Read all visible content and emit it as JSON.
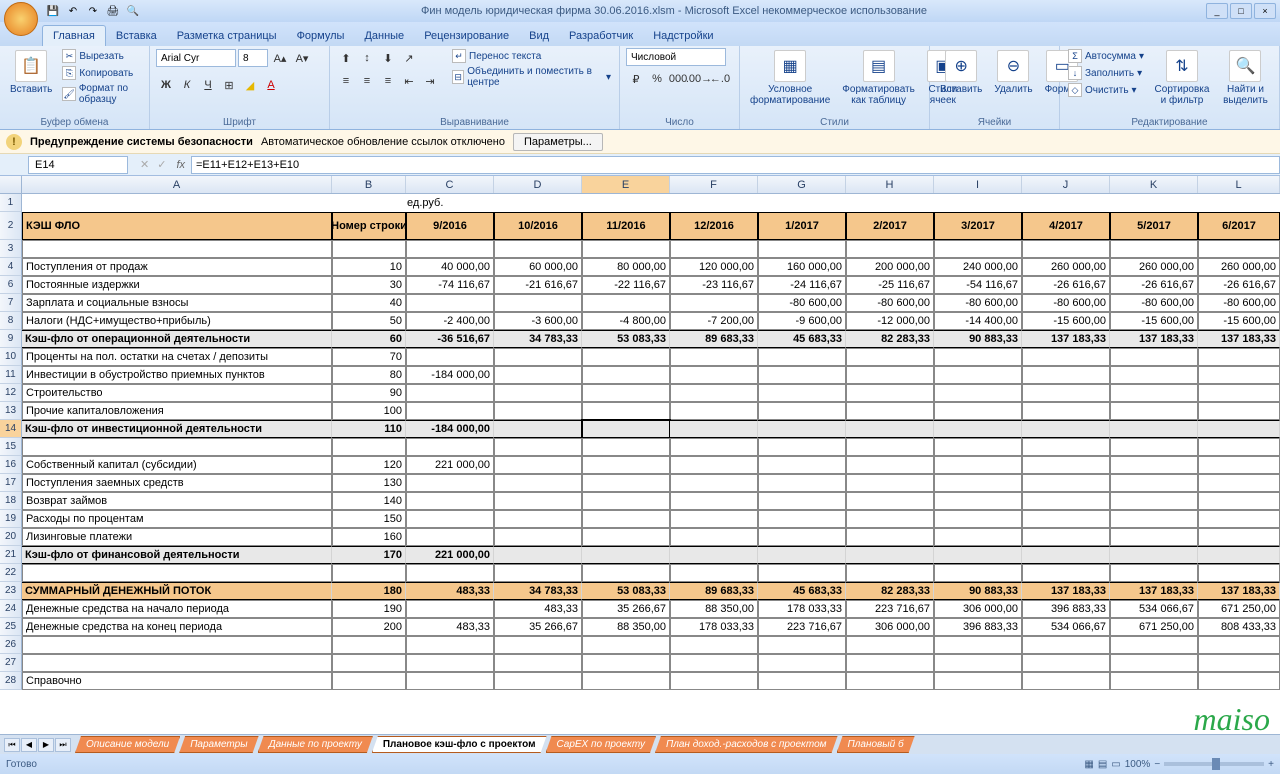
{
  "title": "Фин модель юридическая фирма 30.06.2016.xlsm - Microsoft Excel некоммерческое использование",
  "qat": {
    "save": "💾",
    "undo": "↶",
    "redo": "↷",
    "print": "🖨",
    "preview": "🔍"
  },
  "tabs": [
    "Главная",
    "Вставка",
    "Разметка страницы",
    "Формулы",
    "Данные",
    "Рецензирование",
    "Вид",
    "Разработчик",
    "Надстройки"
  ],
  "ribbon": {
    "clipboard": {
      "paste": "Вставить",
      "cut": "Вырезать",
      "copy": "Копировать",
      "format": "Формат по образцу",
      "label": "Буфер обмена"
    },
    "font": {
      "name": "Arial Cyr",
      "size": "8",
      "label": "Шрифт"
    },
    "align": {
      "wrap": "Перенос текста",
      "merge": "Объединить и поместить в центре",
      "label": "Выравнивание"
    },
    "number": {
      "format": "Числовой",
      "label": "Число"
    },
    "styles": {
      "cond": "Условное форматирование",
      "table": "Форматировать как таблицу",
      "cell": "Стили ячеек",
      "label": "Стили"
    },
    "cells": {
      "insert": "Вставить",
      "delete": "Удалить",
      "format": "Формат",
      "label": "Ячейки"
    },
    "editing": {
      "sum": "Автосумма",
      "fill": "Заполнить",
      "clear": "Очистить",
      "sort": "Сортировка и фильтр",
      "find": "Найти и выделить",
      "label": "Редактирование"
    }
  },
  "warning": {
    "title": "Предупреждение системы безопасности",
    "msg": "Автоматическое обновление ссылок отключено",
    "btn": "Параметры..."
  },
  "namebox": "E14",
  "formula": "=E11+E12+E13+E10",
  "cols": [
    "A",
    "B",
    "C",
    "D",
    "E",
    "F",
    "G",
    "H",
    "I",
    "J",
    "K",
    "L"
  ],
  "unit": "ед.руб.",
  "hdr": {
    "title": "КЭШ ФЛО",
    "rownum": "Номер строки",
    "periods": [
      "9/2016",
      "10/2016",
      "11/2016",
      "12/2016",
      "1/2017",
      "2/2017",
      "3/2017",
      "4/2017",
      "5/2017",
      "6/2017"
    ]
  },
  "rows": [
    {
      "n": 4,
      "label": "Поступления от продаж",
      "rn": "10",
      "v": [
        "40 000,00",
        "60 000,00",
        "80 000,00",
        "120 000,00",
        "160 000,00",
        "200 000,00",
        "240 000,00",
        "260 000,00",
        "260 000,00",
        "260 000,00"
      ]
    },
    {
      "n": 6,
      "label": "Постоянные издержки",
      "rn": "30",
      "v": [
        "-74 116,67",
        "-21 616,67",
        "-22 116,67",
        "-23 116,67",
        "-24 116,67",
        "-25 116,67",
        "-54 116,67",
        "-26 616,67",
        "-26 616,67",
        "-26 616,67"
      ]
    },
    {
      "n": 7,
      "label": "Зарплата и социальные взносы",
      "rn": "40",
      "v": [
        "",
        "",
        "",
        "",
        "-80 600,00",
        "-80 600,00",
        "-80 600,00",
        "-80 600,00",
        "-80 600,00",
        "-80 600,00"
      ]
    },
    {
      "n": 8,
      "label": "Налоги (НДС+имущество+прибыль)",
      "rn": "50",
      "v": [
        "-2 400,00",
        "-3 600,00",
        "-4 800,00",
        "-7 200,00",
        "-9 600,00",
        "-12 000,00",
        "-14 400,00",
        "-15 600,00",
        "-15 600,00",
        "-15 600,00"
      ]
    },
    {
      "n": 9,
      "label": "Кэш-фло от операционной деятельности",
      "rn": "60",
      "bold": true,
      "v": [
        "-36 516,67",
        "34 783,33",
        "53 083,33",
        "89 683,33",
        "45 683,33",
        "82 283,33",
        "90 883,33",
        "137 183,33",
        "137 183,33",
        "137 183,33"
      ]
    },
    {
      "n": 10,
      "label": "Проценты на пол. остатки на счетах / депозиты",
      "rn": "70",
      "v": [
        "",
        "",
        "",
        "",
        "",
        "",
        "",
        "",
        "",
        ""
      ]
    },
    {
      "n": 11,
      "label": "Инвестиции в обустройство приемных пунктов",
      "rn": "80",
      "v": [
        "-184 000,00",
        "",
        "",
        "",
        "",
        "",
        "",
        "",
        "",
        ""
      ]
    },
    {
      "n": 12,
      "label": "Строительство",
      "rn": "90",
      "v": [
        "",
        "",
        "",
        "",
        "",
        "",
        "",
        "",
        "",
        ""
      ]
    },
    {
      "n": 13,
      "label": "Прочие капиталовложения",
      "rn": "100",
      "v": [
        "",
        "",
        "",
        "",
        "",
        "",
        "",
        "",
        "",
        ""
      ]
    },
    {
      "n": 14,
      "label": "Кэш-фло от инвестиционной деятельности",
      "rn": "110",
      "bold": true,
      "active": true,
      "v": [
        "-184 000,00",
        "",
        "",
        "",
        "",
        "",
        "",
        "",
        "",
        ""
      ]
    },
    {
      "n": 15,
      "label": "",
      "rn": "",
      "v": [
        "",
        "",
        "",
        "",
        "",
        "",
        "",
        "",
        "",
        ""
      ]
    },
    {
      "n": 16,
      "label": "Собственный капитал (субсидии)",
      "rn": "120",
      "v": [
        "221 000,00",
        "",
        "",
        "",
        "",
        "",
        "",
        "",
        "",
        ""
      ]
    },
    {
      "n": 17,
      "label": "Поступления заемных средств",
      "rn": "130",
      "v": [
        "",
        "",
        "",
        "",
        "",
        "",
        "",
        "",
        "",
        ""
      ]
    },
    {
      "n": 18,
      "label": "Возврат займов",
      "rn": "140",
      "v": [
        "",
        "",
        "",
        "",
        "",
        "",
        "",
        "",
        "",
        ""
      ]
    },
    {
      "n": 19,
      "label": "Расходы по процентам",
      "rn": "150",
      "v": [
        "",
        "",
        "",
        "",
        "",
        "",
        "",
        "",
        "",
        ""
      ]
    },
    {
      "n": 20,
      "label": "Лизинговые платежи",
      "rn": "160",
      "v": [
        "",
        "",
        "",
        "",
        "",
        "",
        "",
        "",
        "",
        ""
      ]
    },
    {
      "n": 21,
      "label": "Кэш-фло от финансовой деятельности",
      "rn": "170",
      "bold": true,
      "v": [
        "221 000,00",
        "",
        "",
        "",
        "",
        "",
        "",
        "",
        "",
        ""
      ]
    },
    {
      "n": 22,
      "label": "",
      "rn": "",
      "v": [
        "",
        "",
        "",
        "",
        "",
        "",
        "",
        "",
        "",
        ""
      ]
    },
    {
      "n": 23,
      "label": "СУММАРНЫЙ ДЕНЕЖНЫЙ ПОТОК",
      "rn": "180",
      "sum": true,
      "v": [
        "483,33",
        "34 783,33",
        "53 083,33",
        "89 683,33",
        "45 683,33",
        "82 283,33",
        "90 883,33",
        "137 183,33",
        "137 183,33",
        "137 183,33"
      ]
    },
    {
      "n": 24,
      "label": "Денежные средства на начало периода",
      "rn": "190",
      "v": [
        "",
        "483,33",
        "35 266,67",
        "88 350,00",
        "178 033,33",
        "223 716,67",
        "306 000,00",
        "396 883,33",
        "534 066,67",
        "671 250,00"
      ]
    },
    {
      "n": 25,
      "label": "Денежные средства на конец периода",
      "rn": "200",
      "v": [
        "483,33",
        "35 266,67",
        "88 350,00",
        "178 033,33",
        "223 716,67",
        "306 000,00",
        "396 883,33",
        "534 066,67",
        "671 250,00",
        "808 433,33"
      ]
    },
    {
      "n": 26,
      "label": "",
      "rn": "",
      "v": [
        "",
        "",
        "",
        "",
        "",
        "",
        "",
        "",
        "",
        ""
      ]
    },
    {
      "n": 27,
      "label": "",
      "rn": "",
      "v": [
        "",
        "",
        "",
        "",
        "",
        "",
        "",
        "",
        "",
        ""
      ]
    },
    {
      "n": 28,
      "label": "Справочно",
      "rn": "",
      "v": [
        "",
        "",
        "",
        "",
        "",
        "",
        "",
        "",
        "",
        ""
      ]
    }
  ],
  "sheets": [
    "Описание модели",
    "Параметры",
    "Данные по проекту",
    "Плановое кэш-фло с проектом",
    "CapEX по проекту",
    "План доход.-расходов с проектом",
    "Плановый б"
  ],
  "activeSheet": 3,
  "status": {
    "ready": "Готово",
    "zoom": "100%"
  },
  "watermark": "maiso"
}
